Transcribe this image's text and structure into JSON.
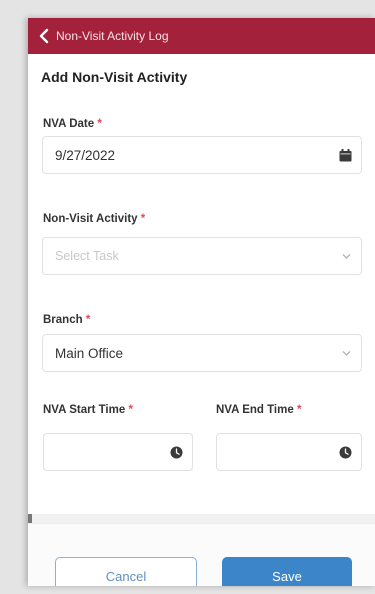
{
  "header": {
    "back_icon": "chevron-left-icon",
    "title": "Non-Visit Activity Log"
  },
  "form": {
    "section_title": "Add Non-Visit Activity",
    "required_marker": "*",
    "nva_date": {
      "label": "NVA Date",
      "value": "9/27/2022",
      "icon": "calendar-icon"
    },
    "activity": {
      "label": "Non-Visit Activity",
      "placeholder": "Select Task",
      "icon": "chevron-down-icon"
    },
    "branch": {
      "label": "Branch",
      "value": "Main Office",
      "icon": "chevron-down-icon"
    },
    "start_time": {
      "label": "NVA Start Time",
      "value": "",
      "icon": "clock-icon"
    },
    "end_time": {
      "label": "NVA End Time",
      "value": "",
      "icon": "clock-icon"
    }
  },
  "footer": {
    "cancel_label": "Cancel",
    "save_label": "Save"
  },
  "colors": {
    "header_bg": "#a3213a",
    "primary": "#3d85c9",
    "required": "#e04a5a"
  }
}
